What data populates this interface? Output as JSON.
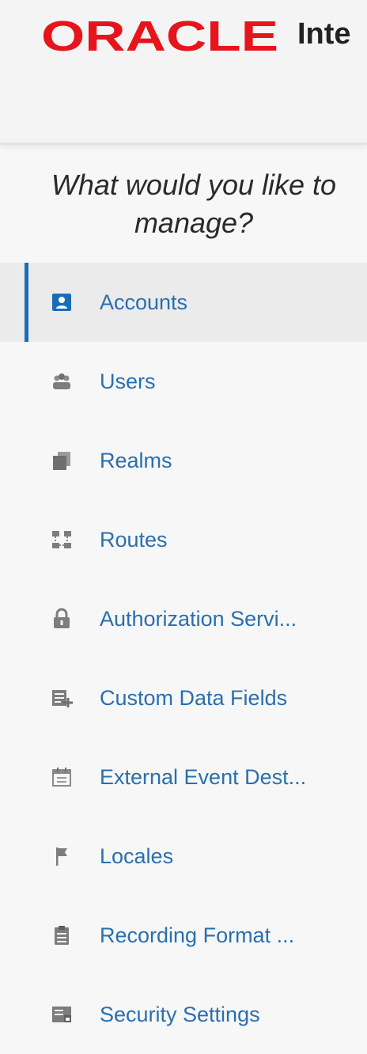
{
  "header": {
    "logo_text": "ORACLE",
    "app_title": "Inte"
  },
  "prompt": {
    "line1": "What would you like to",
    "line2": "manage?"
  },
  "nav": {
    "items": [
      {
        "label": "Accounts",
        "icon": "accounts-icon",
        "active": true
      },
      {
        "label": "Users",
        "icon": "users-icon"
      },
      {
        "label": "Realms",
        "icon": "realms-icon"
      },
      {
        "label": "Routes",
        "icon": "routes-icon"
      },
      {
        "label": "Authorization Servi...",
        "icon": "lock-icon"
      },
      {
        "label": "Custom Data Fields",
        "icon": "custom-data-fields-icon"
      },
      {
        "label": "External Event Dest...",
        "icon": "calendar-icon"
      },
      {
        "label": "Locales",
        "icon": "flag-icon"
      },
      {
        "label": "Recording Format ...",
        "icon": "clipboard-icon"
      },
      {
        "label": "Security Settings",
        "icon": "security-settings-icon"
      }
    ]
  },
  "colors": {
    "logo_red": "#e8141b",
    "link_blue": "#2a6fae",
    "active_bar": "#1a6cb8",
    "icon_gray": "#7d7d7d"
  }
}
